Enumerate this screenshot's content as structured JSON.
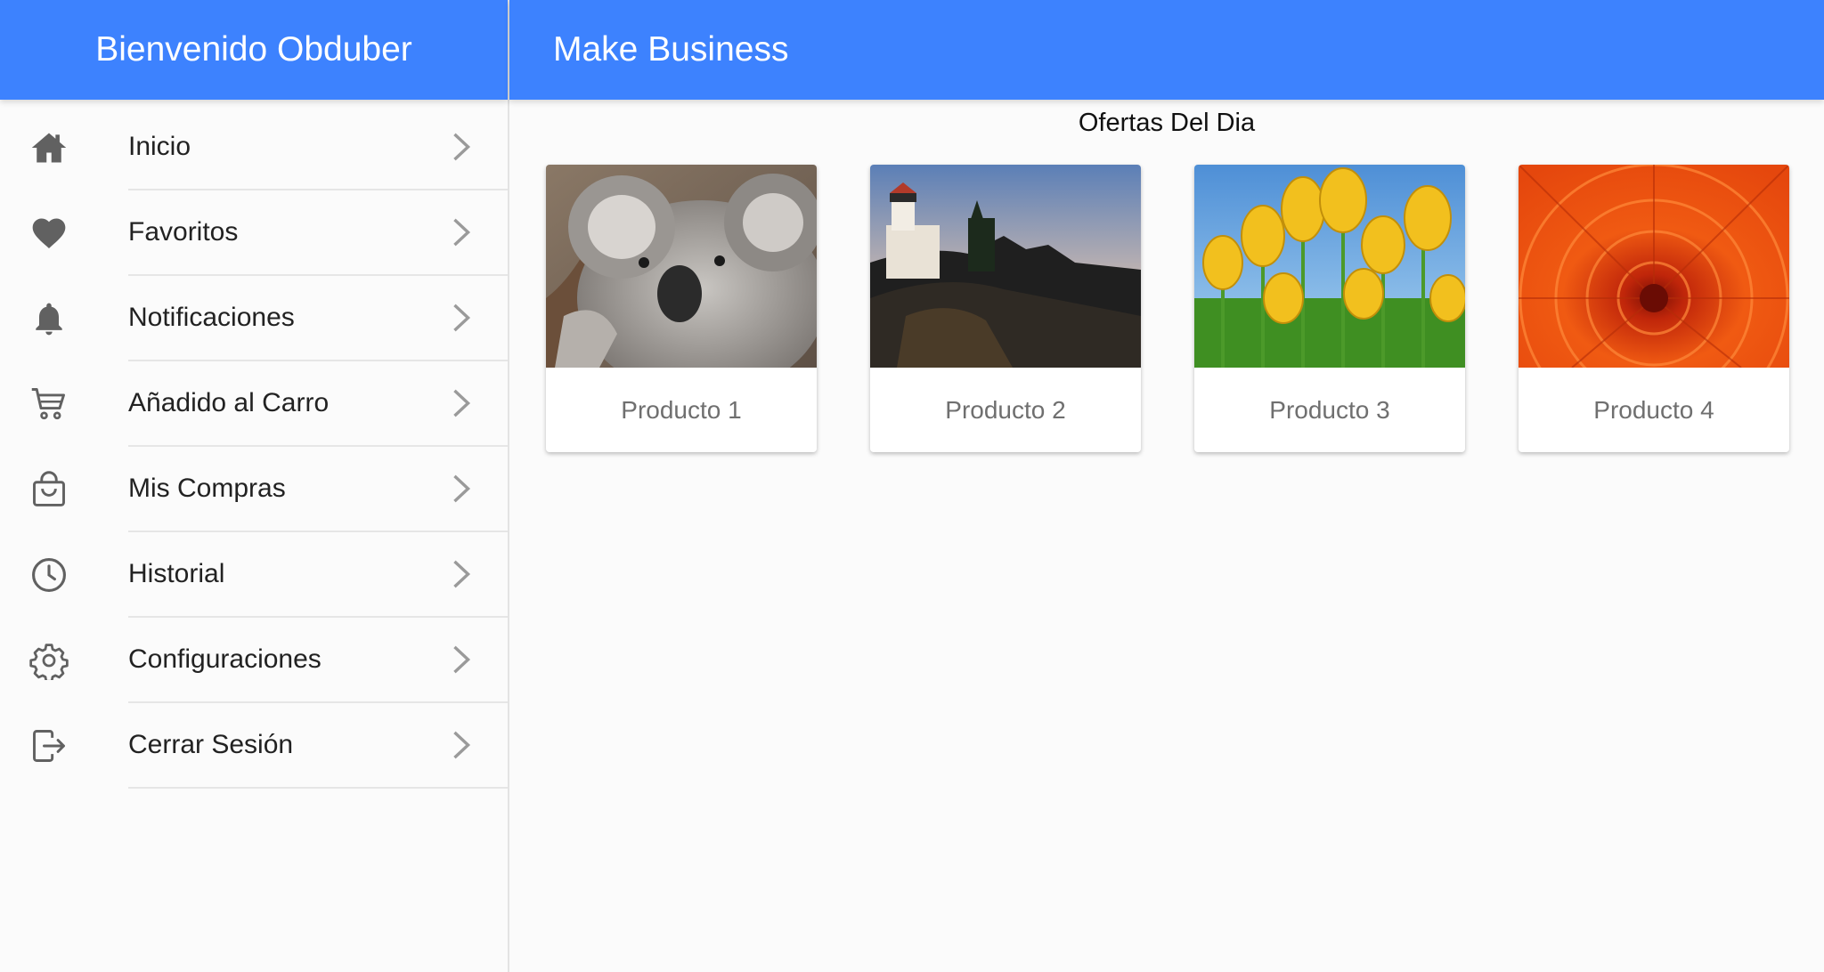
{
  "sidebar": {
    "header": "Bienvenido Obduber",
    "items": [
      {
        "label": "Inicio",
        "icon": "home-icon"
      },
      {
        "label": "Favoritos",
        "icon": "heart-icon"
      },
      {
        "label": "Notificaciones",
        "icon": "bell-icon"
      },
      {
        "label": "Añadido al Carro",
        "icon": "cart-icon"
      },
      {
        "label": "Mis Compras",
        "icon": "shopping-bag-icon"
      },
      {
        "label": "Historial",
        "icon": "clock-icon"
      },
      {
        "label": "Configuraciones",
        "icon": "gear-icon"
      },
      {
        "label": "Cerrar Sesión",
        "icon": "logout-icon"
      }
    ]
  },
  "header": {
    "title": "Make Business"
  },
  "main": {
    "section_title": "Ofertas Del Dia",
    "products": [
      {
        "name": "Producto 1",
        "image": "koala-photo"
      },
      {
        "name": "Producto 2",
        "image": "lighthouse-photo"
      },
      {
        "name": "Producto 3",
        "image": "tulips-photo"
      },
      {
        "name": "Producto 4",
        "image": "chrysanthemum-photo"
      }
    ]
  },
  "colors": {
    "primary": "#3d82fe",
    "icon": "#616161",
    "background": "#fbfbfb",
    "card_text": "#6f6f6f"
  }
}
